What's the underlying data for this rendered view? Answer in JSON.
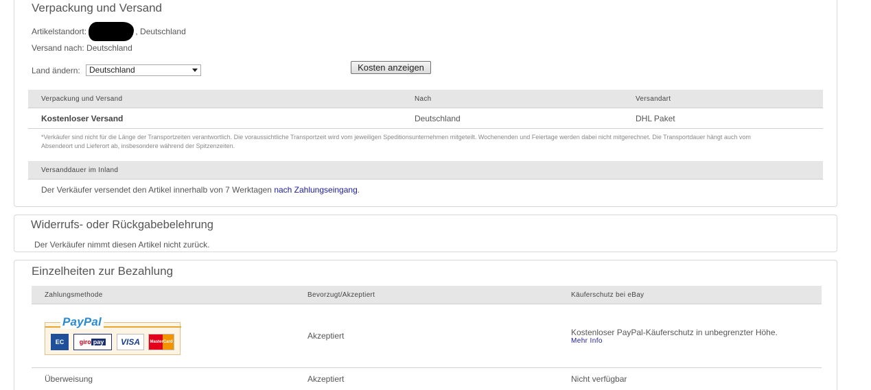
{
  "shipping": {
    "title": "Verpackung und Versand",
    "location_label": "Artikelstandort:",
    "location_country": ", Deutschland",
    "ship_to": "Versand nach: Deutschland",
    "change_country_label": "Land ändern:",
    "country_selected": "Deutschland",
    "show_costs_button": "Kosten anzeigen",
    "table": {
      "headers": [
        "Verpackung und Versand",
        "Nach",
        "Versandart"
      ],
      "rows": [
        {
          "cost": "Kostenloser Versand",
          "to": "Deutschland",
          "method": "DHL Paket"
        }
      ]
    },
    "note": "*Verkäufer sind nicht für die Länge der Transportzeiten verantwortlich. Die voraussichtliche Transportzeit wird vom jeweiligen Speditionsunternehmen mitgeteilt. Wochenenden und Feiertage werden dabei nicht mitgerechnet. Die Transportdauer hängt auch vom Absendeort und Lieferort ab, insbesondere während der Spitzenzeiten.",
    "domestic_header": "Versanddauer im Inland",
    "domestic_text": "Der Verkäufer versendet den Artikel innerhalb von 7 Werktagen ",
    "domestic_link": "nach Zahlungseingang",
    "domestic_end": "."
  },
  "returns": {
    "title": "Widerrufs- oder Rückgabebelehrung",
    "text": "Der Verkäufer nimmt diesen Artikel nicht zurück."
  },
  "payment": {
    "title": "Einzelheiten zur Bezahlung",
    "headers": [
      "Zahlungsmethode",
      "Bevorzugt/Akzeptiert",
      "Käuferschutz bei eBay"
    ],
    "paypal_logo_a": "Pay",
    "paypal_logo_b": "Pal",
    "cards": {
      "ec": "EC",
      "giropay_a": "giro",
      "giropay_b": "pay",
      "visa": "VISA",
      "mastercard": "MasterCard"
    },
    "rows": [
      {
        "status": "Akzeptiert",
        "protection": "Kostenloser PayPal-Käuferschutz in unbegrenzter Höhe.",
        "more_link": "Mehr Info"
      },
      {
        "method": "Überweisung",
        "status": "Akzeptiert",
        "protection": "Nicht verfügbar"
      }
    ]
  }
}
